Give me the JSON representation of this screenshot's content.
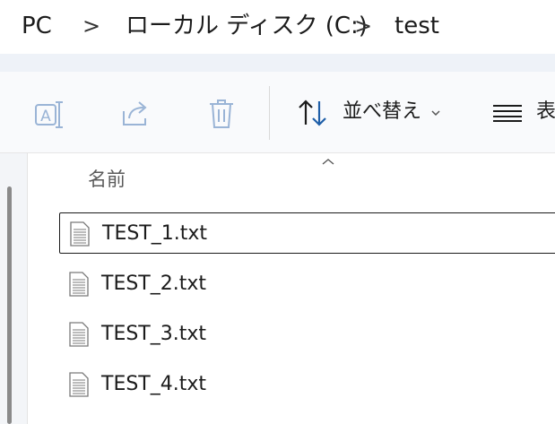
{
  "breadcrumb": {
    "items": [
      "PC",
      "ローカル ディスク (C:)",
      "test"
    ],
    "separator": ">"
  },
  "toolbar": {
    "rename_icon": "rename-icon",
    "share_icon": "share-icon",
    "delete_icon": "trash-icon",
    "sort_label": "並べ替え",
    "sort_icon": "sort-arrows-icon",
    "view_label": "表",
    "view_icon": "view-lines-icon"
  },
  "file_list": {
    "column_name": "名前",
    "files": [
      {
        "name": "TEST_1.txt",
        "selected": true
      },
      {
        "name": "TEST_2.txt",
        "selected": false
      },
      {
        "name": "TEST_3.txt",
        "selected": false
      },
      {
        "name": "TEST_4.txt",
        "selected": false
      }
    ]
  },
  "colors": {
    "accent": "#1f5fa8",
    "disabled_icon": "#9ab4d6",
    "selection_border": "#1b1b1b"
  }
}
